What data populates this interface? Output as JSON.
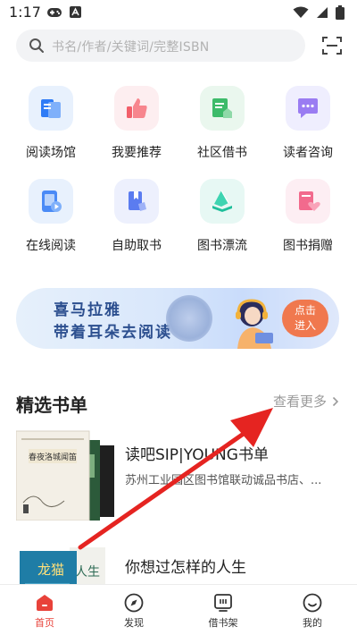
{
  "status_bar": {
    "time": "1:17"
  },
  "search": {
    "placeholder": "书名/作者/关键词/完整ISBN"
  },
  "grid": {
    "items": [
      {
        "label": "阅读场馆",
        "color": "#e8f1fd"
      },
      {
        "label": "我要推荐",
        "color": "#fdeef0"
      },
      {
        "label": "社区借书",
        "color": "#eaf7ee"
      },
      {
        "label": "读者咨询",
        "color": "#efeefe"
      },
      {
        "label": "在线阅读",
        "color": "#e8f1fd"
      },
      {
        "label": "自助取书",
        "color": "#edf0fd"
      },
      {
        "label": "图书漂流",
        "color": "#e7f8f4"
      },
      {
        "label": "图书捐赠",
        "color": "#fdeef3"
      }
    ]
  },
  "banner": {
    "line1": "喜马拉雅",
    "line2": "带着耳朵去阅读",
    "cta_line1": "点击",
    "cta_line2": "进入"
  },
  "section": {
    "title": "精选书单",
    "more": "查看更多"
  },
  "book_lists": [
    {
      "title": "读吧SIP|YOUNG书单",
      "desc": "苏州工业园区图书馆联动诚品书店、..."
    },
    {
      "title": "你想过怎样的人生",
      "desc": ""
    }
  ],
  "tabs": [
    {
      "label": "首页",
      "active": true
    },
    {
      "label": "发现",
      "active": false
    },
    {
      "label": "借书架",
      "active": false
    },
    {
      "label": "我的",
      "active": false
    }
  ],
  "colors": {
    "accent": "#e8423a",
    "banner_cta": "#f0784e",
    "annotation_arrow": "#e52421"
  }
}
